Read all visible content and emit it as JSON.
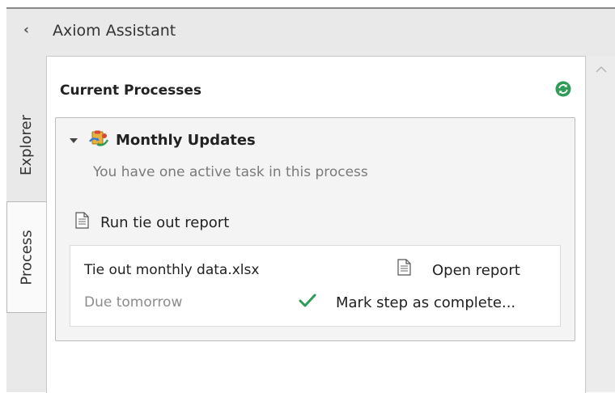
{
  "app": {
    "title": "Axiom Assistant"
  },
  "side_tabs": [
    {
      "label": "Explorer",
      "active": false
    },
    {
      "label": "Process",
      "active": true
    }
  ],
  "panel": {
    "title": "Current Processes",
    "refresh_icon": "refresh-icon"
  },
  "process": {
    "title": "Monthly Updates",
    "subtitle": "You have one active task in this process",
    "expanded": true,
    "step": {
      "label": "Run tie out report",
      "icon": "document-icon"
    },
    "task": {
      "name": "Tie out monthly data.xlsx",
      "due": "Due tomorrow",
      "open_label": "Open report",
      "complete_label": "Mark step as complete..."
    }
  },
  "colors": {
    "window_bg": "#e9e9e9",
    "accent_green": "#2e9b57",
    "muted_text": "#7a7a7a"
  }
}
